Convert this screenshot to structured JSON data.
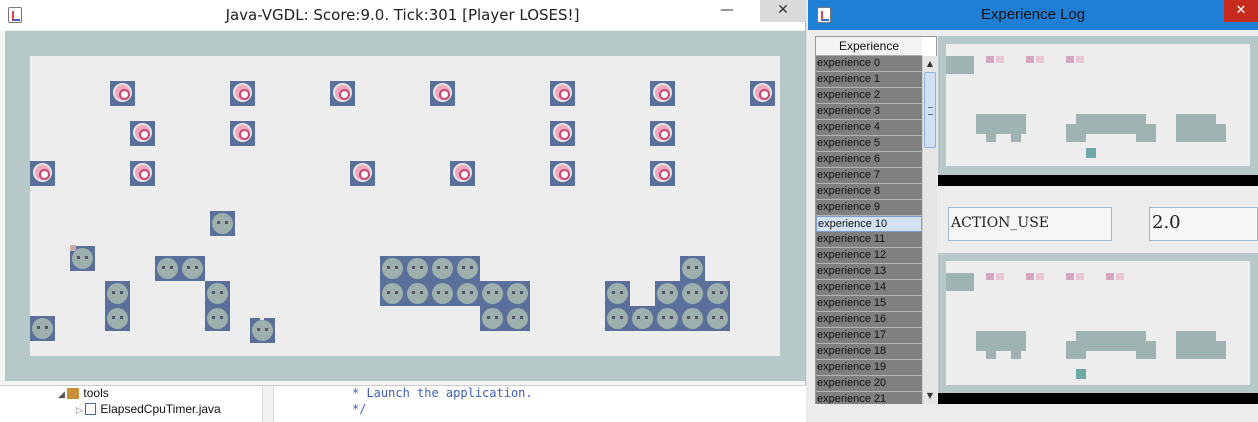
{
  "game_window": {
    "title": "Java-VGDL: Score:9.0. Tick:301 [Player LOSES!]",
    "minimize": "—",
    "close": "✕"
  },
  "ide": {
    "tree": [
      {
        "label": "tools"
      },
      {
        "label": "ElapsedCpuTimer.java"
      }
    ],
    "code": [
      "* Launch the application.",
      "*/"
    ]
  },
  "log_window": {
    "title": "Experience Log",
    "close": "✕",
    "list_header": "Experience",
    "selected_index": 10,
    "items": [
      "experience 0",
      "experience 1",
      "experience 2",
      "experience 3",
      "experience 4",
      "experience 5",
      "experience 6",
      "experience 7",
      "experience 8",
      "experience 9",
      "experience 10",
      "experience 11",
      "experience 12",
      "experience 13",
      "experience 14",
      "experience 15",
      "experience 16",
      "experience 17",
      "experience 18",
      "experience 19",
      "experience 20",
      "experience 21"
    ],
    "action": "ACTION_USE",
    "reward": "2.0"
  },
  "colors": {
    "wall": "#b6c8c8",
    "floor": "#ededed",
    "sprite_bg": "#5a6f99",
    "log_titlebar": "#1f7fd6",
    "selected_row": "#d3e2f3"
  }
}
